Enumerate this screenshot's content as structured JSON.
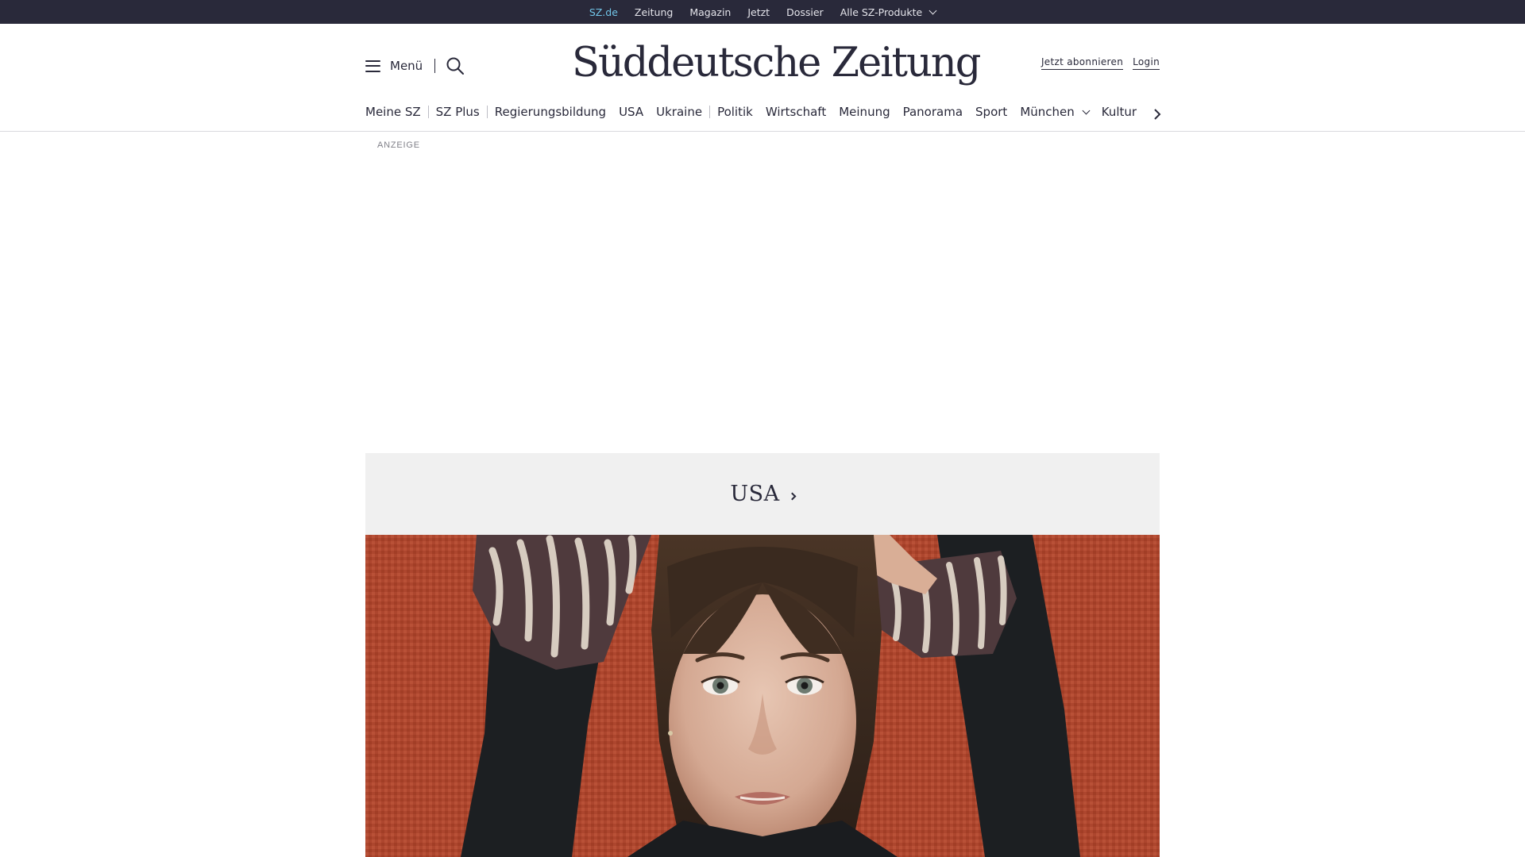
{
  "topbar": {
    "links": [
      "SZ.de",
      "Zeitung",
      "Magazin",
      "Jetzt",
      "Dossier",
      "Alle SZ-Produkte"
    ],
    "active_index": 0,
    "accent_color": "#71c5e8",
    "background_color": "#29293a"
  },
  "header": {
    "menu_label": "Menü",
    "menu_icon": "hamburger-icon",
    "search_icon": "search-icon",
    "logo_text": "Süddeutsche Zeitung",
    "subscribe_label": "Jetzt abonnieren",
    "login_label": "Login"
  },
  "nav": {
    "items": [
      "Meine SZ",
      "SZ Plus",
      "Regierungsbildung",
      "USA",
      "Ukraine",
      "Politik",
      "Wirtschaft",
      "Meinung",
      "Panorama",
      "Sport",
      "München",
      "Kultur"
    ],
    "next_icon": "chevron-right-icon"
  },
  "ad": {
    "label": "ANZEIGE"
  },
  "section": {
    "title": "USA",
    "chevron_icon": "chevron-right-icon"
  },
  "hero": {
    "icon": "portrait-photo",
    "background_color": "#b44c32"
  }
}
